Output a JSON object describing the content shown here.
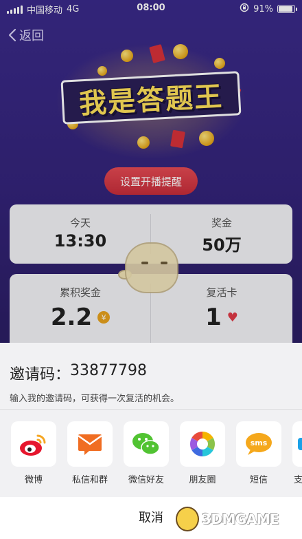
{
  "status_bar": {
    "carrier": "中国移动",
    "network": "4G",
    "time": "08:00",
    "battery_percent": "91%",
    "battery_level": 0.91
  },
  "nav": {
    "back_label": "返回"
  },
  "banner": {
    "title": "我是答题王"
  },
  "remind_button": "设置开播提醒",
  "card1": {
    "left": {
      "label": "今天",
      "value": "13:30"
    },
    "right": {
      "label": "奖金",
      "value": "50万"
    }
  },
  "card2": {
    "left": {
      "label": "累积奖金",
      "value": "2.2",
      "badge": "¥"
    },
    "right": {
      "label": "复活卡",
      "value": "1"
    }
  },
  "sheet": {
    "invite_label": "邀请码：",
    "invite_code": "33877798",
    "invite_desc": "输入我的邀请码，可获得一次复活的机会。",
    "share_items": [
      {
        "label": "微博",
        "icon": "weibo-icon"
      },
      {
        "label": "私信和群",
        "icon": "message-icon"
      },
      {
        "label": "微信好友",
        "icon": "wechat-icon"
      },
      {
        "label": "朋友圈",
        "icon": "moments-icon"
      },
      {
        "label": "短信",
        "icon": "sms-icon"
      },
      {
        "label": "支",
        "icon": "more-icon"
      }
    ],
    "cancel_label": "取消"
  },
  "watermark": {
    "text": "3DMGAME"
  },
  "colors": {
    "accent": "#d8323a",
    "background": "#2b1c66",
    "sheet": "#f1f1f3"
  }
}
